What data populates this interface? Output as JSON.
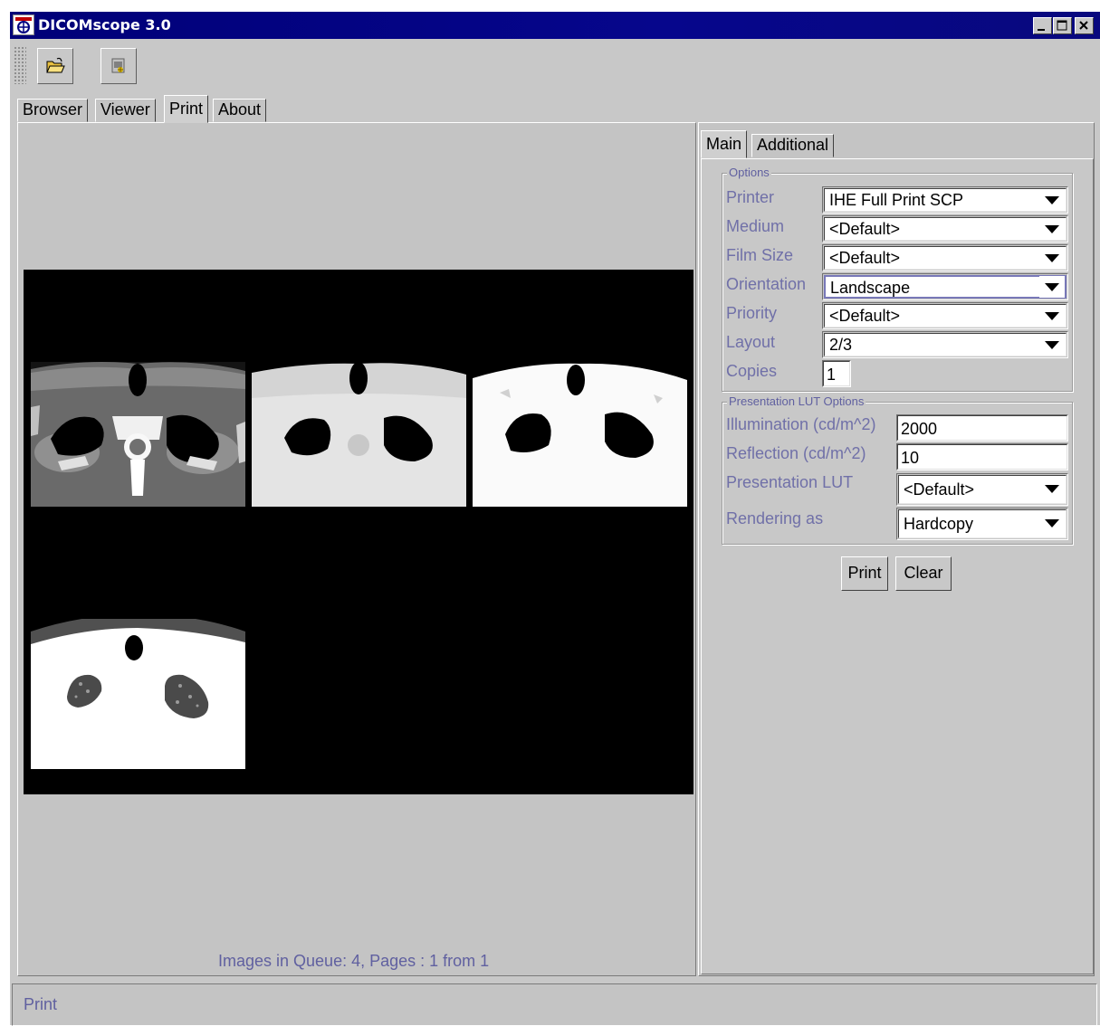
{
  "window": {
    "title": "DICOMscope 3.0",
    "buttons": {
      "minimize": "_",
      "maximize": "□",
      "close": "×"
    }
  },
  "toolbar": {
    "items": [
      {
        "icon": "open-folder-icon"
      },
      {
        "icon": "load-image-icon"
      }
    ]
  },
  "main_tabs": {
    "items": [
      {
        "label": "Browser"
      },
      {
        "label": "Viewer"
      },
      {
        "label": "Print"
      },
      {
        "label": "About"
      }
    ],
    "selected": "Print"
  },
  "preview": {
    "layout": "2/3",
    "images": [
      {
        "style": "ct-bone-window"
      },
      {
        "style": "ct-soft-tissue-window"
      },
      {
        "style": "ct-high-contrast-window"
      },
      {
        "style": "ct-lung-window"
      }
    ],
    "queue_text": "Images in Queue: 4, Pages : 1 from 1"
  },
  "side_tabs": {
    "items": [
      {
        "label": "Main"
      },
      {
        "label": "Additional"
      }
    ],
    "selected": "Main"
  },
  "options": {
    "legend": "Options",
    "printer": {
      "label": "Printer",
      "value": "IHE Full Print SCP"
    },
    "medium": {
      "label": "Medium",
      "value": "<Default>"
    },
    "film_size": {
      "label": "Film Size",
      "value": "<Default>"
    },
    "orientation": {
      "label": "Orientation",
      "value": "Landscape"
    },
    "priority": {
      "label": "Priority",
      "value": "<Default>"
    },
    "layout": {
      "label": "Layout",
      "value": "2/3"
    },
    "copies": {
      "label": "Copies",
      "value": "1"
    }
  },
  "lut_options": {
    "legend": "Presentation LUT Options",
    "illumination": {
      "label": "Illumination (cd/m^2)",
      "value": "2000"
    },
    "reflection": {
      "label": "Reflection (cd/m^2)",
      "value": "10"
    },
    "presentation_lut": {
      "label": "Presentation LUT",
      "value": "<Default>"
    },
    "rendering_as": {
      "label": "Rendering as",
      "value": "Hardcopy"
    }
  },
  "actions": {
    "print_label": "Print",
    "clear_label": "Clear"
  },
  "status_bar": {
    "text": "Print"
  }
}
